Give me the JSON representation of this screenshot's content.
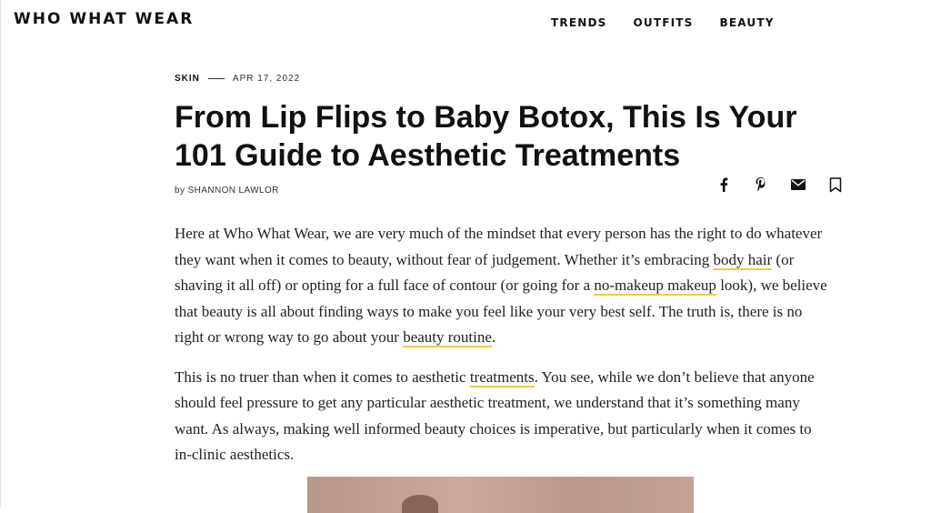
{
  "site": {
    "logo": "WHO WHAT WEAR"
  },
  "nav": {
    "items": [
      "TRENDS",
      "OUTFITS",
      "BEAUTY"
    ]
  },
  "article": {
    "category": "SKIN",
    "date": "APR 17, 2022",
    "title": "From Lip Flips to Baby Botox, This Is Your 101 Guide to Aesthetic Treatments",
    "byline_prefix": "by",
    "author": "SHANNON LAWLOR",
    "share_icons": [
      "facebook-icon",
      "pinterest-icon",
      "mail-icon",
      "bookmark-icon"
    ],
    "p1": {
      "t1": "Here at Who What Wear, we are very much of the mindset that every person has the right to do whatever they want when it comes to beauty, without fear of judgement. Whether it’s embracing ",
      "link1": "body hair",
      "t2": " (or shaving it all off) or opting for a full face of contour (or going for a ",
      "link2": "no-makeup makeup",
      "t3": " look), we believe that beauty is all about finding ways to make you feel like your very best self. The truth is, there is no right or wrong way to go about your ",
      "link3": "beauty routine",
      "t4": "."
    },
    "p2": {
      "t1": "This is no truer than when it comes to aesthetic ",
      "link1": "treatments",
      "t2": ". You see, while we don’t believe that anyone should feel pressure to get any particular aesthetic treatment, we understand that it’s something many want. As always, making well informed beauty choices is imperative, but particularly when it comes to in-clinic aesthetics."
    }
  },
  "colors": {
    "link_underline": "#f2c94c",
    "text": "#222222"
  }
}
